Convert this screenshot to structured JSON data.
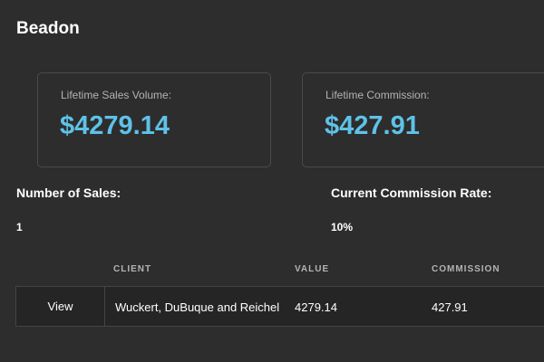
{
  "page": {
    "title": "Beadon"
  },
  "cards": {
    "sales_volume_label": "Lifetime Sales Volume:",
    "sales_volume_value": "$4279.14",
    "commission_label": "Lifetime Commission:",
    "commission_value": "$427.91"
  },
  "stats": {
    "sales_count_label": "Number of Sales:",
    "sales_count_value": "1",
    "commission_rate_label": "Current Commission Rate:",
    "commission_rate_value": "10%"
  },
  "table": {
    "headers": {
      "client": "CLIENT",
      "value": "VALUE",
      "commission": "COMMISSION"
    },
    "rows": [
      {
        "action": "View",
        "client": "Wuckert, DuBuque and Reichel",
        "value": "4279.14",
        "commission": "427.91"
      }
    ]
  },
  "colors": {
    "background": "#2d2d2d",
    "accent": "#5ec2e8",
    "border": "#4a4a4a"
  }
}
